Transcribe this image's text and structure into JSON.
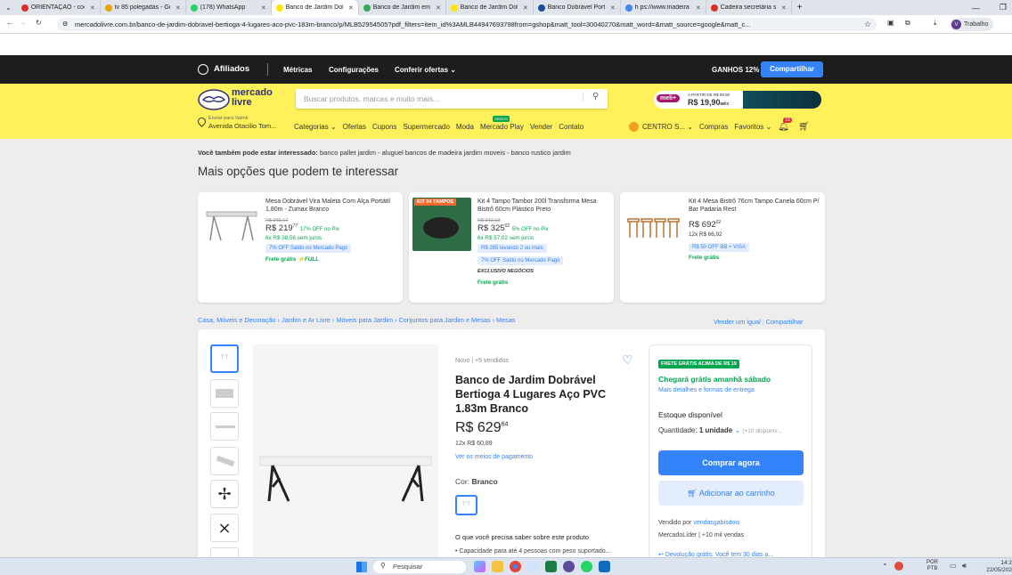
{
  "browser": {
    "tabs": [
      {
        "label": "ORIENTAÇÃO - coord",
        "color": "#d93025"
      },
      {
        "label": "tv 85 polegadas - Go",
        "color": "#e8a400"
      },
      {
        "label": "(178) WhatsApp",
        "color": "#25d366"
      },
      {
        "label": "Banco de Jardim Dob",
        "color": "#ffe600",
        "active": true
      },
      {
        "label": "Banco de Jardim em",
        "color": "#34a853"
      },
      {
        "label": "Banco de Jardim Dob",
        "color": "#ffe600"
      },
      {
        "label": "Banco Dobrável Port",
        "color": "#1a4d9c"
      },
      {
        "label": "h ps://www.madeira",
        "color": "#4285f4"
      },
      {
        "label": "Cadeira secretária sk",
        "color": "#d93025"
      }
    ],
    "url": "mercadolivre.com.br/banco-de-jardim-dobravel-bertioga-4-lugares-aco-pvc-183m-branco/p/MLB52954505?pdf_filters=item_id%3AMLB44947693798from=gshop&matt_tool=30040270&matt_word=&matt_source=google&matt_c...",
    "profile_label": "Trabalho"
  },
  "affiliates": {
    "brand": "Afiliados",
    "links": [
      "Métricas",
      "Configurações",
      "Conferir ofertas"
    ],
    "earnings": "GANHOS 12%",
    "share_button": "Compartilhar"
  },
  "header": {
    "logo_line1": "mercado",
    "logo_line2": "livre",
    "search_placeholder": "Buscar produtos, marcas e muito mais...",
    "promo_badge": "meli+",
    "promo_small": "A PARTIR DE R$ 69,90",
    "promo_price": "R$ 19,90",
    "promo_period": "MÊS",
    "location_small": "Enviar para Valmir",
    "location_main": "Avenida Otacilio Tom...",
    "nav": [
      "Categorias",
      "Ofertas",
      "Cupons",
      "Supermercado",
      "Moda",
      "Mercado Play",
      "Vender",
      "Contato"
    ],
    "nav_badge": "GRÁTIS",
    "user": "CENTRO S...",
    "user_links": [
      "Compras",
      "Favoritos"
    ],
    "notif_count": "15"
  },
  "interest": {
    "label_bold": "Você também pode estar interessado:",
    "label_rest": " banco pallet jardim - aluguel bancos de madeira jardim moveis - banco rustico jardim",
    "title": "Mais opções que podem te interessar"
  },
  "recs": [
    {
      "title": "Mesa Dobrável Vira Maleta Com Alça Portátil 1,80m - Zumax Branco",
      "old_price": "R$ 265,17",
      "price": "R$ 219",
      "cents": "77",
      "off": "17% OFF no Pix",
      "installments": "6x R$ 38,56 sem juros",
      "pills": [
        "7% OFF Saldo no Mercado Pago"
      ],
      "shipping": "Frete grátis",
      "full": "FULL"
    },
    {
      "tag": "KIT 04 TAMPOS",
      "title": "Kit 4 Tampo Tambor 200l Transforma Mesa Bistrô 60cm Plástico Preto",
      "old_price": "R$ 342,13",
      "price": "R$ 325",
      "cents": "02",
      "off": "5% OFF no Pix",
      "installments": "6x R$ 57,02 sem juros",
      "pills": [
        "R$ 285 levando 2 ou mais",
        "7% OFF Saldo no Mercado Pago"
      ],
      "exclusive": "EXCLUSIVO NEGÓCIOS",
      "shipping": "Frete grátis"
    },
    {
      "title": "Kit 4 Mesa Bistrô 76cm Tampo Canela 60cm P/ Bar Padaria Rest",
      "price": "R$ 692",
      "cents": "02",
      "installments": "12x R$ 66,92",
      "pills": [
        "R$ 50 OFF BB + VISA"
      ],
      "shipping": "Frete grátis"
    }
  ],
  "breadcrumb": [
    "Casa, Móveis e Decoração",
    "Jardim e Ar Livre",
    "Móveis para Jardim",
    "Conjuntos para Jardim e Mesas",
    "Mesas"
  ],
  "breadcrumb_actions": [
    "Vender um igual",
    "Compartilhar"
  ],
  "product": {
    "condition": "Novo  |  +5 vendidos",
    "title": "Banco de Jardim Dobrável Bertioga 4 Lugares Aço PVC 1.83m Branco",
    "price": "R$ 629",
    "cents": "64",
    "installments": "12x R$ 60,89",
    "payment_link": "Ver os meios de pagamento",
    "color_label": "Cor:",
    "color_value": "Branco",
    "about": "O que você precisa saber sobre este produto",
    "bullet": "Capacidade para até 4 pessoas com peso suportado..."
  },
  "buybox": {
    "free_badge": "FRETE GRÁTIS ACIMA DE R$ 19",
    "arrival": "Chegará grátis amanhã sábado",
    "details_link": "Mais detalhes e formas de entrega",
    "stock": "Estoque disponível",
    "qty_label": "Quantidade:",
    "qty_value": "1 unidade",
    "qty_more": "(+10 disponív...",
    "buy_button": "Comprar agora",
    "cart_button": "Adicionar ao carrinho",
    "seller_prefix": "Vendido por",
    "seller": "vendasgabisdois",
    "seller_info": "MercadoLíder | +10 mil vendas",
    "return_text": "Devolução grátis. Você tem 30 dias a..."
  },
  "taskbar": {
    "search_placeholder": "Pesquisar",
    "lang1": "POR",
    "lang2": "PTB",
    "time": "14:2",
    "date": "22/05/202"
  },
  "colors": {
    "ml_yellow": "#fff159",
    "ml_blue": "#3483fa",
    "ml_green": "#00a650"
  }
}
